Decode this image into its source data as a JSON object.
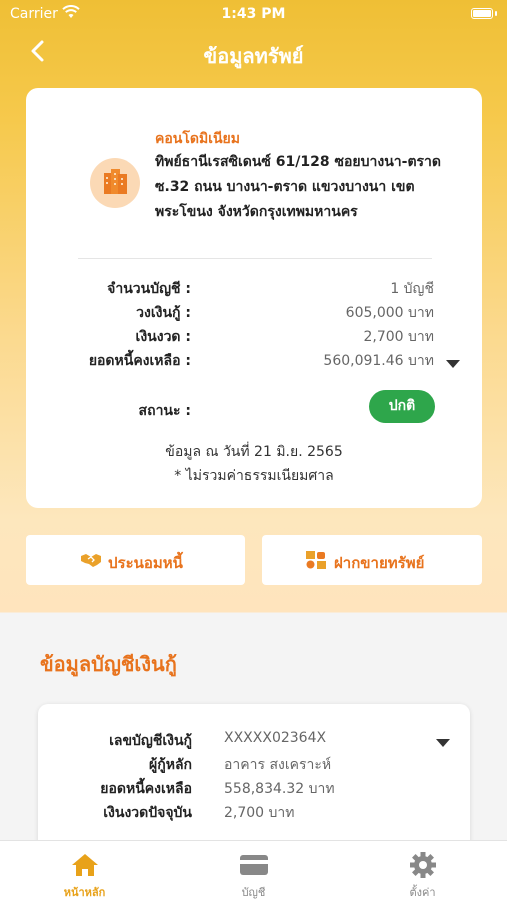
{
  "status_bar": {
    "carrier": "Carrier",
    "time": "1:43 PM"
  },
  "nav": {
    "title": "ข้อมูลทรัพย์"
  },
  "property": {
    "type": "คอนโดมิเนียม",
    "address": "ทิพย์ธานีเรสซิเดนซ์ 61/128 ซอยบางนา-ตราด ซ.32 ถนน บางนา-ตราด แขวงบางนา เขตพระโขนง จังหวัดกรุงเทพมหานคร",
    "rows": [
      {
        "label": "จำนวนบัญชี :",
        "value": "1 บัญชี"
      },
      {
        "label": "วงเงินกู้ :",
        "value": "605,000 บาท"
      },
      {
        "label": "เงินงวด :",
        "value": "2,700 บาท"
      },
      {
        "label": "ยอดหนี้คงเหลือ :",
        "value": "560,091.46 บาท"
      }
    ],
    "status_label": "สถานะ :",
    "status_value": "ปกติ",
    "as_of": "ข้อมูล ณ วันที่ 21 มิ.ย. 2565",
    "note": "* ไม่รวมค่าธรรมเนียมศาล"
  },
  "actions": {
    "negotiate": "ประนอมหนี้",
    "consign": "ฝากขายทรัพย์"
  },
  "loan_section": {
    "title": "ข้อมูลบัญชีเงินกู้",
    "rows": [
      {
        "label": "เลขบัญชีเงินกู้",
        "value": "XXXXX02364X"
      },
      {
        "label": "ผู้กู้หลัก",
        "value": "อาคาร สงเคราะห์"
      },
      {
        "label": "ยอดหนี้คงเหลือ",
        "value": "558,834.32 บาท"
      },
      {
        "label": "เงินงวดปัจจุบัน",
        "value": "2,700 บาท"
      }
    ]
  },
  "tabs": [
    {
      "label": "หน้าหลัก",
      "icon": "home-icon",
      "active": true
    },
    {
      "label": "บัญชี",
      "icon": "card-icon",
      "active": false
    },
    {
      "label": "ตั้งค่า",
      "icon": "gear-icon",
      "active": false
    }
  ],
  "colors": {
    "accent": "#e8731d",
    "brand_yellow": "#f2c53d",
    "status_green": "#2ea64b",
    "tab_active": "#e8a21a"
  }
}
